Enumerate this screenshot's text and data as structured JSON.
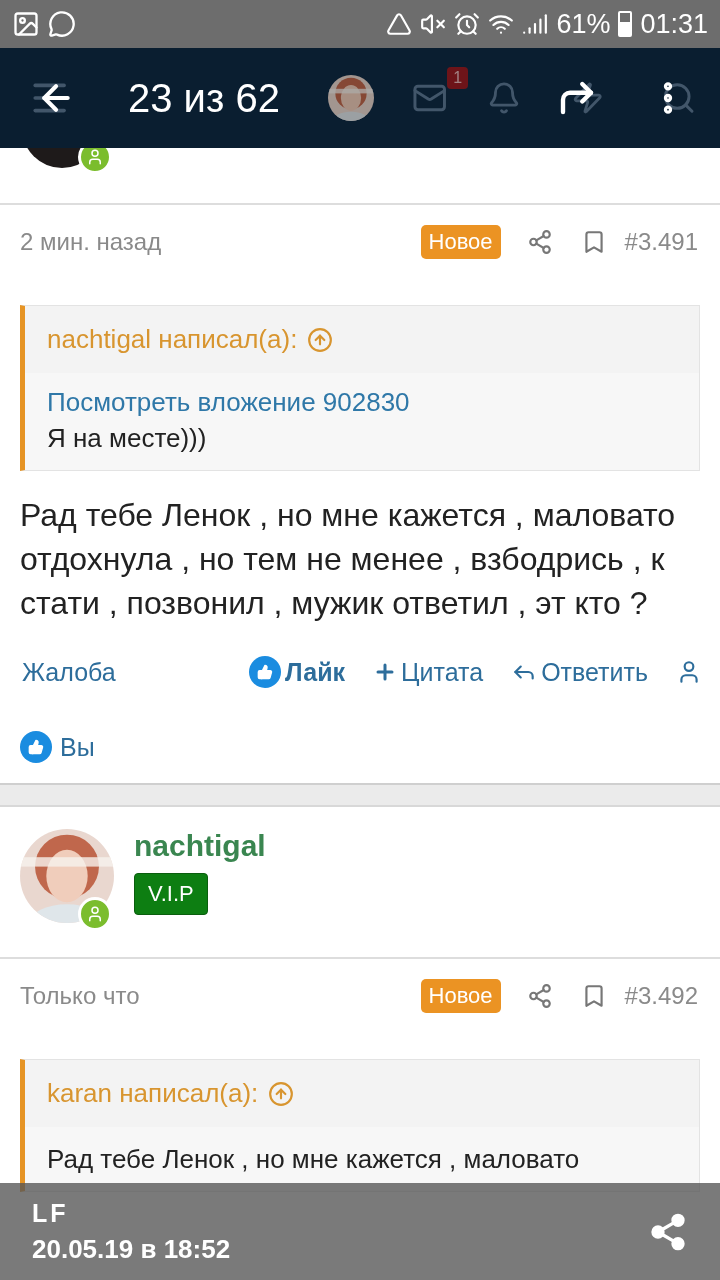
{
  "status_bar": {
    "battery": "61%",
    "time": "01:31"
  },
  "forum_header": {
    "notification_count": "1"
  },
  "viewer": {
    "counter": "23 из 62",
    "author": "LF",
    "date": "20.05.19 в 18:52"
  },
  "posts": [
    {
      "time": "2 мин. назад",
      "badge": "Новое",
      "number": "#3.491",
      "quote": {
        "author_line": "nachtigal написал(а):",
        "link": "Посмотреть вложение 902830",
        "text": "Я на месте)))"
      },
      "message": "Рад тебе Ленок , но мне кажется , маловато отдохнула , но тем не менее , взбодрись , к стати , позвонил , мужик ответил , эт кто ?",
      "liked": true,
      "actions": [
        {
          "kind": "report",
          "label": "Жалоба"
        },
        {
          "kind": "like",
          "label": "Лайк"
        },
        {
          "kind": "quote",
          "label": "Цитата"
        },
        {
          "kind": "reply",
          "label": "Ответить"
        },
        {
          "kind": "user"
        }
      ],
      "likes": "Вы"
    },
    {
      "author": {
        "name": "nachtigal",
        "title": "V.I.P"
      },
      "time": "Только что",
      "badge": "Новое",
      "number": "#3.492",
      "quote": {
        "author_line": "karan написал(а):",
        "text": "Рад тебе Ленок , но мне кажется , маловато"
      }
    }
  ]
}
